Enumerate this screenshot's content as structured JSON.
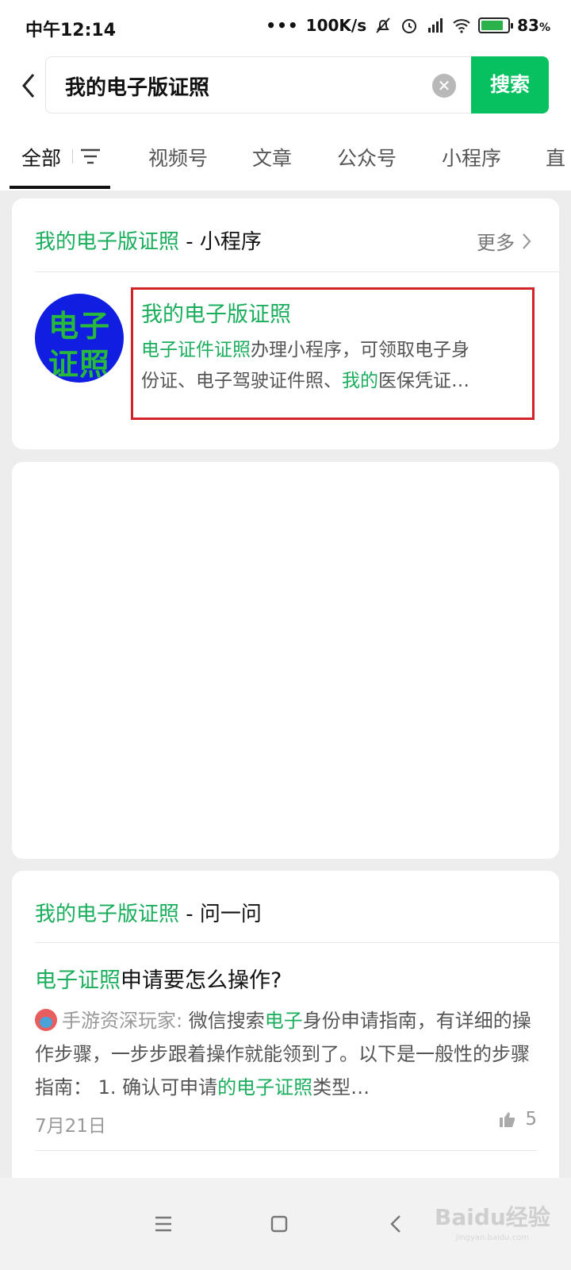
{
  "status_bar": {
    "time": "中午12:14",
    "network_speed": "100K/s",
    "battery_percent": "83",
    "battery_suffix": "%",
    "battery_level": 0.83
  },
  "search": {
    "query": "我的电子版证照",
    "button_label": "搜索"
  },
  "tabs": [
    {
      "label": "全部",
      "active": true
    },
    {
      "label": "视频号"
    },
    {
      "label": "文章"
    },
    {
      "label": "公众号"
    },
    {
      "label": "小程序"
    },
    {
      "label": "直"
    }
  ],
  "miniprogram_card": {
    "title_keyword": "我的电子版证照",
    "title_suffix": " - 小程序",
    "more_label": "更多",
    "app": {
      "logo_text_line1": "电子",
      "logo_text_line2": "证照",
      "name": "我的电子版证照",
      "desc_part1": "电子证件证照",
      "desc_part2": "办理小程序，可领取电子身",
      "desc_part3": "份证、电子驾驶证件照、",
      "desc_part4": "我的",
      "desc_part5": "医保凭证…"
    }
  },
  "qa_card": {
    "title_keyword": "我的电子版证照",
    "title_suffix": " - 问一问",
    "question_keyword": "电子证照",
    "question_rest": "申请要怎么操作?",
    "author": "手游资深玩家:",
    "answer_part1": " 微信搜索",
    "answer_part2": "电子",
    "answer_part3": "身份申请指南，有详细的操作步骤，一步步跟着操作就能领到了。以下是一般性的步骤指南：  1. 确认可申请",
    "answer_part4": "的电子证照",
    "answer_part5": "类型…",
    "date": "7月21日",
    "likes": "5"
  },
  "watermark": {
    "text": "Baidu经验",
    "sub": "jingyan.baidu.com"
  },
  "colors": {
    "accent_green": "#07c160",
    "keyword_green": "#1aad5c",
    "highlight_red": "#d32229",
    "logo_blue": "#0f1ee0"
  }
}
